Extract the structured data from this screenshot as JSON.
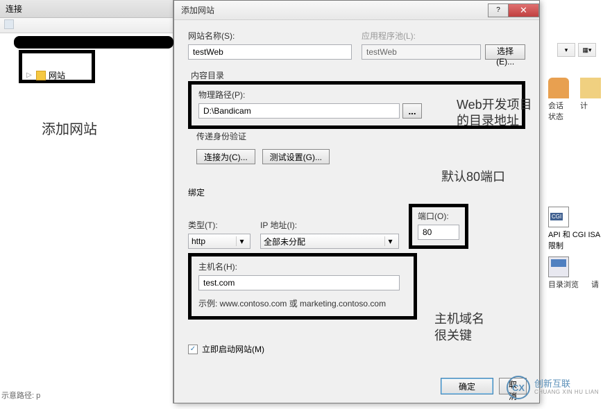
{
  "left": {
    "header": "连接",
    "sites_label": "网站",
    "annotation": "添加网站",
    "bottom": "示意路径: p"
  },
  "dialog": {
    "title": "添加网站",
    "site_name_label": "网站名称(S):",
    "site_name_value": "testWeb",
    "app_pool_label": "应用程序池(L):",
    "app_pool_value": "testWeb",
    "select_btn": "选择(E)...",
    "content_dir": "内容目录",
    "physical_path_label": "物理路径(P):",
    "physical_path_value": "D:\\Bandicam",
    "passthrough_label": "传递身份验证",
    "connect_as_btn": "连接为(C)...",
    "test_settings_btn": "测试设置(G)...",
    "binding": {
      "title": "绑定",
      "type_label": "类型(T):",
      "type_value": "http",
      "ip_label": "IP 地址(I):",
      "ip_value": "全部未分配",
      "port_label": "端口(O):",
      "port_value": "80",
      "host_label": "主机名(H):",
      "host_value": "test.com",
      "example": "示例: www.contoso.com 或 marketing.contoso.com"
    },
    "start_immediately": "立即启动网站(M)",
    "ok_btn": "确定",
    "cancel_btn": "取消"
  },
  "right": {
    "session_state": "会话状态",
    "ji": "计",
    "isapi_cgi": "API 和 CGI ISA",
    "restrict": "限制",
    "browse": "目录浏览",
    "ri": "请"
  },
  "annot": {
    "path": "Web开发项目的目录地址",
    "port": "默认80端口",
    "host": "主机域名\n很关键"
  },
  "logo": {
    "main": "创新互联",
    "sub": "CHUANG XIN HU LIAN"
  }
}
